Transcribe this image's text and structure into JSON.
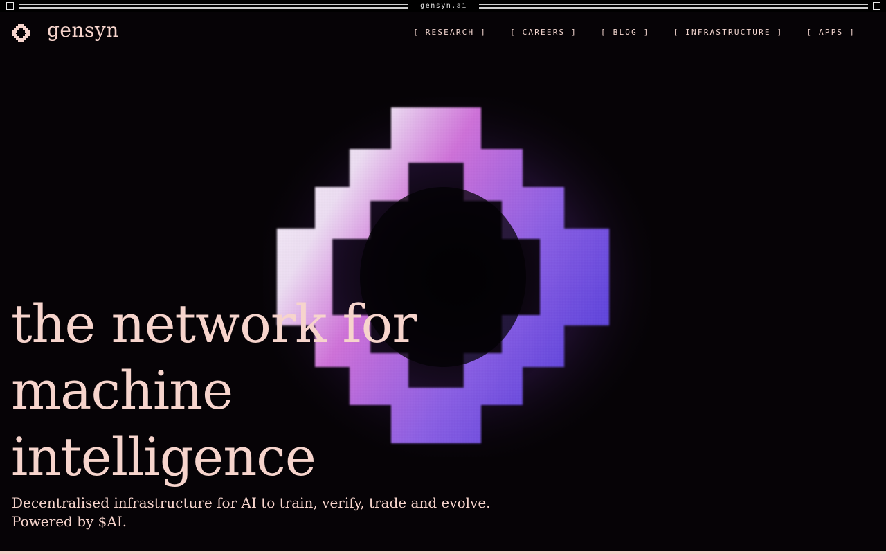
{
  "window": {
    "title": "gensyn.ai"
  },
  "header": {
    "logo_text": "gensyn",
    "nav": [
      {
        "label": "[ RESEARCH ]"
      },
      {
        "label": "[ CAREERS ]"
      },
      {
        "label": "[ BLOG ]"
      },
      {
        "label": "[ INFRASTRUCTURE ]"
      },
      {
        "label": "[ APPS ]"
      }
    ]
  },
  "hero": {
    "headline_lines": [
      "the network for",
      "machine",
      "intelligence"
    ],
    "subheadline_lines": [
      "Decentralised infrastructure for AI to train, verify, trade and evolve.",
      "Powered by $AI."
    ]
  },
  "colors": {
    "background": "#060306",
    "text": "#f6d4cc",
    "accent_magenta": "#c65ad6",
    "accent_blue": "#6b4cf0"
  }
}
